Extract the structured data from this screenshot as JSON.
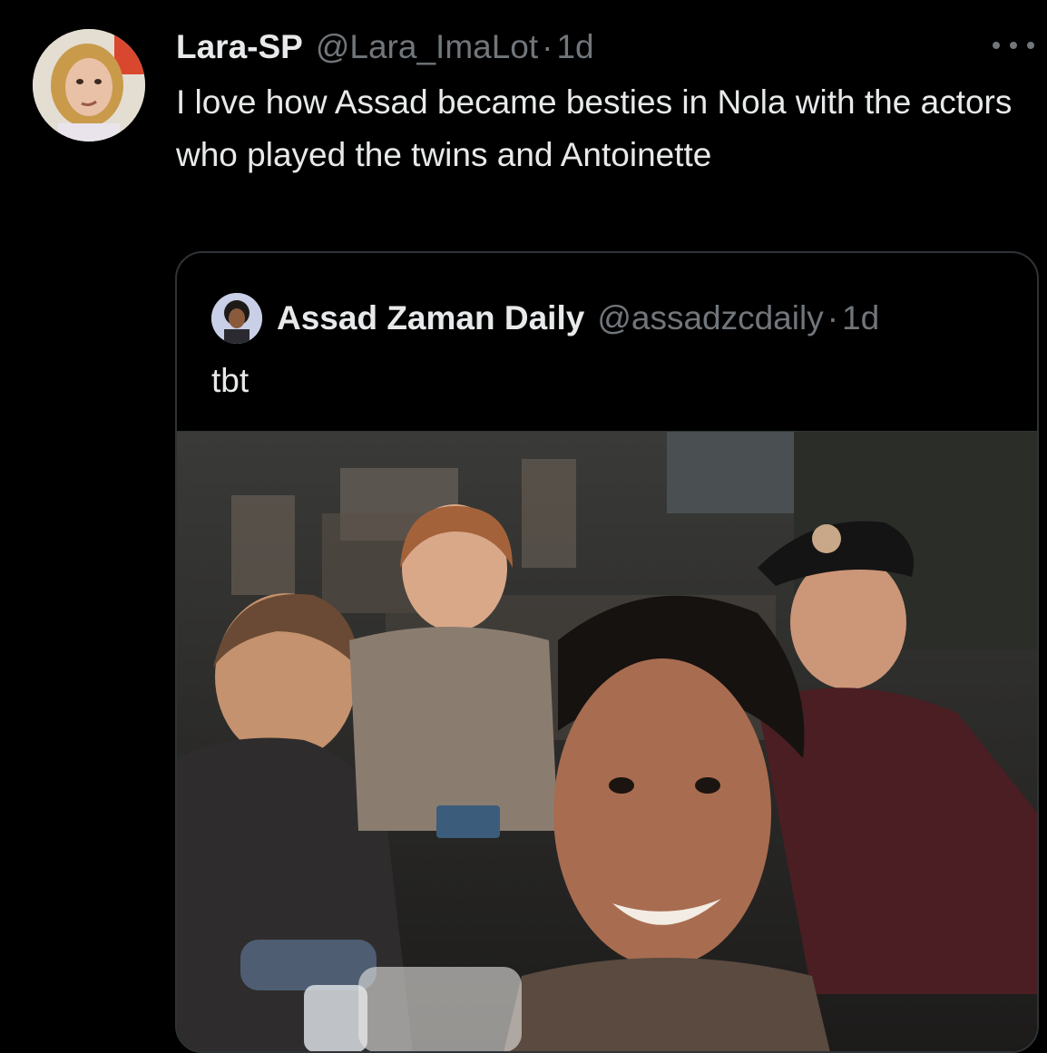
{
  "tweet": {
    "display_name": "Lara-SP",
    "handle": "@Lara_ImaLot",
    "separator": "·",
    "time": "1d",
    "text": "I love how Assad became besties in Nola with the actors who played the twins and Antoinette"
  },
  "quoted_tweet": {
    "display_name": "Assad Zaman Daily",
    "handle": "@assadzcdaily",
    "separator": "·",
    "time": "1d",
    "text": "tbt"
  },
  "icons": {
    "more": "more-horizontal-icon"
  },
  "colors": {
    "background": "#000000",
    "primary_text": "#e7e9ea",
    "secondary_text": "#71767b",
    "border": "#2f3336"
  }
}
